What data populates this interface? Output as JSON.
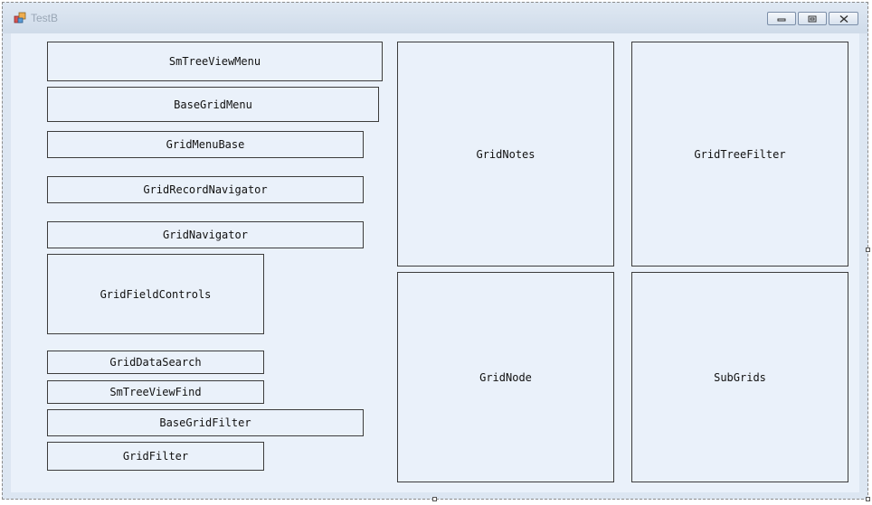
{
  "window": {
    "title": "TestB",
    "buttons": {
      "minimize": "minimize-icon",
      "maximize": "maximize-icon",
      "close": "close-icon"
    }
  },
  "controls": {
    "sm_tree_view_menu": "SmTreeViewMenu",
    "base_grid_menu": "BaseGridMenu",
    "grid_menu_base": "GridMenuBase",
    "grid_record_navigator": "GridRecordNavigator",
    "grid_navigator": "GridNavigator",
    "grid_field_controls": "GridFieldControls",
    "grid_data_search": "GridDataSearch",
    "sm_tree_view_find": "SmTreeViewFind",
    "base_grid_filter": "BaseGridFilter",
    "grid_filter": "GridFilter",
    "grid_notes": "GridNotes",
    "grid_tree_filter": "GridTreeFilter",
    "grid_node": "GridNode",
    "sub_grids": "SubGrids"
  },
  "colors": {
    "client_background": "#eaf1fa",
    "frame_background": "#dce6f2",
    "control_border": "#3c3c3c"
  }
}
